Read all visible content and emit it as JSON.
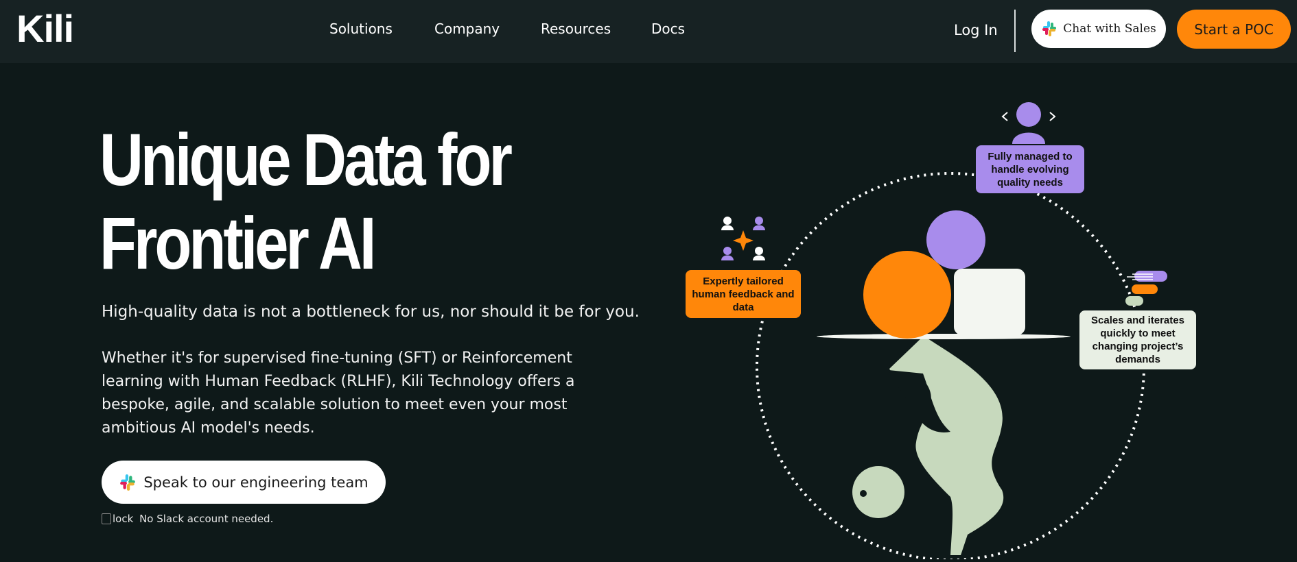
{
  "nav": {
    "logo": "Kili",
    "items": [
      {
        "label": "Solutions"
      },
      {
        "label": "Company"
      },
      {
        "label": "Resources"
      },
      {
        "label": "Docs"
      }
    ],
    "login": "Log In",
    "chat_sales": "Chat with Sales",
    "start_poc": "Start a POC"
  },
  "hero": {
    "title_line1": "Unique Data for",
    "title_line2": "Frontier AI",
    "lead": "High-quality data is not a bottleneck for us, nor should it be for you.",
    "body": "Whether it's for supervised fine-tuning (SFT) or Reinforcement learning with Human Feedback (RLHF), Kili Technology offers a bespoke, agile, and scalable solution to meet even your most ambitious AI model's needs.",
    "cta": "Speak to our engineering team",
    "note_img_alt": "lock",
    "note": "No Slack account needed."
  },
  "illustration": {
    "label_left": "Expertly tailored human feedback and data",
    "label_top": "Fully managed to handle evolving quality needs",
    "label_right": "Scales and iterates quickly to meet changing project’s demands"
  },
  "colors": {
    "background": "#0e1919",
    "nav": "#172223",
    "accent_orange": "#ff870a",
    "accent_purple": "#a88cec",
    "sage": "#c7d9bd",
    "offwhite": "#f3f6f1"
  },
  "icons": {
    "slack": "slack-icon",
    "lock": "lock-icon"
  }
}
